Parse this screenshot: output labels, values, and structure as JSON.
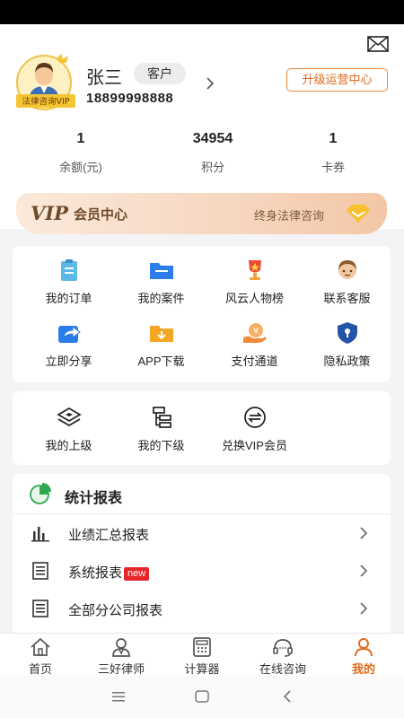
{
  "profile": {
    "name": "张三",
    "role": "客户",
    "phone": "18899998888",
    "avatar_badge": "法律咨询VIP",
    "upgrade_label": "升级运营中心"
  },
  "stats": [
    {
      "value": "1",
      "label": "余额(元)"
    },
    {
      "value": "34954",
      "label": "积分"
    },
    {
      "value": "1",
      "label": "卡券"
    }
  ],
  "vip": {
    "logo": "VIP",
    "title": "会员中心",
    "subtitle": "终身法律咨询"
  },
  "services": [
    {
      "label": "我的订单",
      "icon": "clipboard-icon"
    },
    {
      "label": "我的案件",
      "icon": "folder-icon"
    },
    {
      "label": "风云人物榜",
      "icon": "trophy-icon"
    },
    {
      "label": "联系客服",
      "icon": "customer-service-icon"
    },
    {
      "label": "立即分享",
      "icon": "share-icon"
    },
    {
      "label": "APP下载",
      "icon": "download-icon"
    },
    {
      "label": "支付通道",
      "icon": "payment-icon"
    },
    {
      "label": "隐私政策",
      "icon": "shield-lock-icon"
    }
  ],
  "team": [
    {
      "label": "我的上级",
      "icon": "layers-icon"
    },
    {
      "label": "我的下级",
      "icon": "hierarchy-icon"
    },
    {
      "label": "兑换VIP会员",
      "icon": "exchange-icon"
    }
  ],
  "reports": {
    "title": "统计报表",
    "items": [
      {
        "label": "业绩汇总报表",
        "badge": ""
      },
      {
        "label": "系统报表",
        "badge": "new"
      },
      {
        "label": "全部分公司报表",
        "badge": ""
      }
    ]
  },
  "tabs": [
    {
      "label": "首页",
      "icon": "home-icon"
    },
    {
      "label": "三好律师",
      "icon": "lawyer-icon"
    },
    {
      "label": "计算器",
      "icon": "calculator-icon"
    },
    {
      "label": "在线咨询",
      "icon": "headset-icon"
    },
    {
      "label": "我的",
      "icon": "person-icon"
    }
  ],
  "colors": {
    "accent": "#e06a1c",
    "new_badge": "#e8262a",
    "vip_text": "#6d4a2b"
  }
}
